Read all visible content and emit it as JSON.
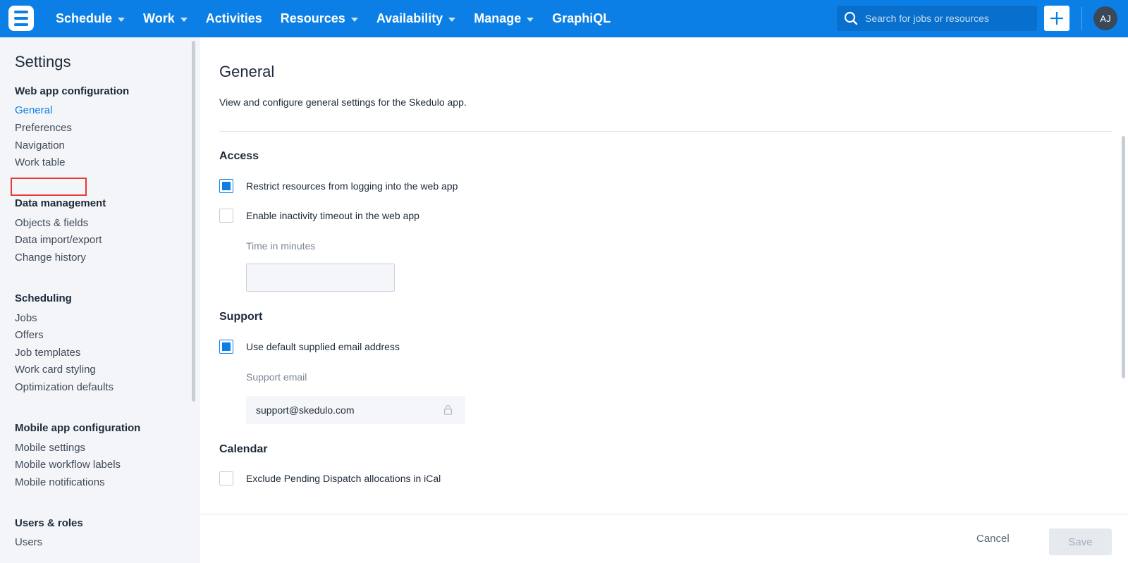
{
  "topnav": {
    "logo_icon": "skedulo-logo-icon",
    "items": [
      {
        "label": "Schedule",
        "has_dropdown": true
      },
      {
        "label": "Work",
        "has_dropdown": true
      },
      {
        "label": "Activities",
        "has_dropdown": false
      },
      {
        "label": "Resources",
        "has_dropdown": true
      },
      {
        "label": "Availability",
        "has_dropdown": true
      },
      {
        "label": "Manage",
        "has_dropdown": true
      },
      {
        "label": "GraphiQL",
        "has_dropdown": false
      }
    ],
    "search": {
      "placeholder": "Search for jobs or resources",
      "value": ""
    },
    "avatar_initials": "AJ"
  },
  "sidebar": {
    "title": "Settings",
    "groups": [
      {
        "title": "Web app configuration",
        "items": [
          "General",
          "Preferences",
          "Navigation",
          "Work table"
        ]
      },
      {
        "title": "Data management",
        "items": [
          "Objects & fields",
          "Data import/export",
          "Change history"
        ]
      },
      {
        "title": "Scheduling",
        "items": [
          "Jobs",
          "Offers",
          "Job templates",
          "Work card styling",
          "Optimization defaults"
        ]
      },
      {
        "title": "Mobile app configuration",
        "items": [
          "Mobile settings",
          "Mobile workflow labels",
          "Mobile notifications"
        ]
      },
      {
        "title": "Users & roles",
        "items": [
          "Users"
        ]
      }
    ],
    "active_item": "General",
    "highlighted_item": "Navigation"
  },
  "main": {
    "title": "General",
    "description": "View and configure general settings for the Skedulo app.",
    "sections": {
      "access": {
        "title": "Access",
        "restrict_label": "Restrict resources from logging into the web app",
        "restrict_checked": true,
        "inactivity_label": "Enable inactivity timeout in the web app",
        "inactivity_checked": false,
        "time_label": "Time in minutes",
        "time_value": ""
      },
      "support": {
        "title": "Support",
        "default_email_label": "Use default supplied email address",
        "default_email_checked": true,
        "email_label": "Support email",
        "email_value": "support@skedulo.com"
      },
      "calendar": {
        "title": "Calendar",
        "exclude_label": "Exclude Pending Dispatch allocations in iCal",
        "exclude_checked": false
      }
    }
  },
  "footer": {
    "cancel_label": "Cancel",
    "save_label": "Save"
  },
  "colors": {
    "brand": "#0b7fe6",
    "highlight": "#e53935"
  }
}
